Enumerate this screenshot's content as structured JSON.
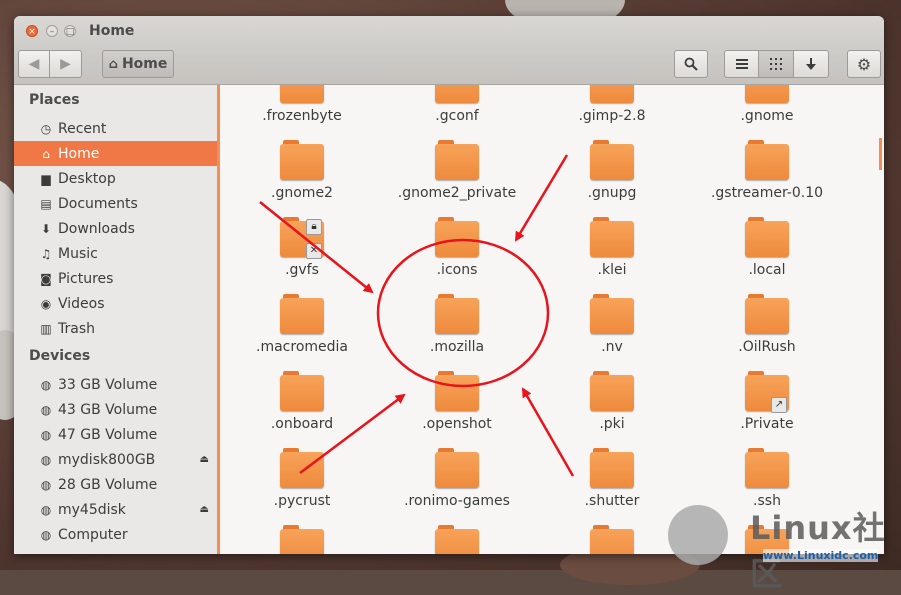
{
  "window": {
    "title": "Home"
  },
  "toolbar": {
    "back_icon": "arrow-left-icon",
    "forward_icon": "arrow-right-icon",
    "path_home_label": "Home",
    "search_icon": "search-icon",
    "list_view_icon": "list-view-icon",
    "grid_view_icon": "grid-view-icon",
    "sort_icon": "sort-down-arrow-icon",
    "menu_icon": "gear-icon"
  },
  "sidebar": {
    "places_heading": "Places",
    "places": [
      {
        "label": "Recent",
        "icon": "recent-icon"
      },
      {
        "label": "Home",
        "icon": "home-icon",
        "active": true
      },
      {
        "label": "Desktop",
        "icon": "desktop-folder-icon"
      },
      {
        "label": "Documents",
        "icon": "documents-icon"
      },
      {
        "label": "Downloads",
        "icon": "downloads-icon"
      },
      {
        "label": "Music",
        "icon": "music-icon"
      },
      {
        "label": "Pictures",
        "icon": "pictures-icon"
      },
      {
        "label": "Videos",
        "icon": "videos-icon"
      },
      {
        "label": "Trash",
        "icon": "trash-icon"
      }
    ],
    "devices_heading": "Devices",
    "devices": [
      {
        "label": "33 GB Volume",
        "icon": "drive-icon"
      },
      {
        "label": "43 GB Volume",
        "icon": "drive-icon"
      },
      {
        "label": "47 GB Volume",
        "icon": "drive-icon"
      },
      {
        "label": "mydisk800GB",
        "icon": "drive-icon",
        "eject": true
      },
      {
        "label": "28 GB Volume",
        "icon": "drive-icon"
      },
      {
        "label": "my45disk",
        "icon": "drive-icon",
        "eject": true
      },
      {
        "label": "Computer",
        "icon": "drive-icon"
      }
    ]
  },
  "files": [
    ".frozenbyte",
    ".gconf",
    ".gimp-2.8",
    ".gnome",
    ".gnome2",
    ".gnome2_private",
    ".gnupg",
    ".gstreamer-0.10",
    ".gvfs",
    ".icons",
    ".klei",
    ".local",
    ".macromedia",
    ".mozilla",
    ".nv",
    ".OilRush",
    ".onboard",
    ".openshot",
    ".pki",
    ".Private",
    ".pycrust",
    ".ronimo-games",
    ".shutter",
    ".ssh"
  ],
  "emblems": {
    "gvfs": [
      "lock-emblem-icon",
      "unreadable-x-emblem-icon"
    ],
    "private": [
      "symlink-arrow-emblem-icon"
    ]
  },
  "annotation": {
    "color": "#e8131b",
    "highlight": ".mozilla"
  },
  "watermark": {
    "text": "Linux社区",
    "url": "www.Linuxidc.com"
  },
  "colors": {
    "accent": "#f07746",
    "folder": "#f29447"
  }
}
